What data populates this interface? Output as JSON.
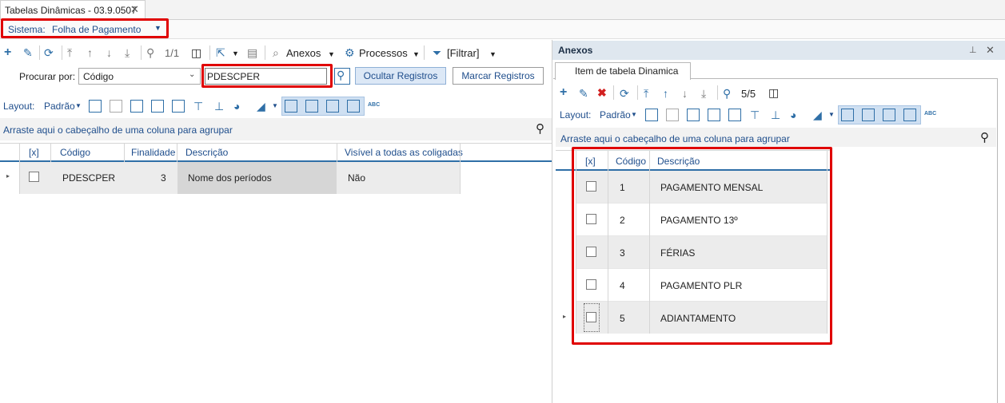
{
  "window": {
    "tab_title": "Tabelas Dinâmicas - 03.9.0507",
    "tab_close": "✕"
  },
  "sistema": {
    "label": "Sistema:",
    "value": "Folha de Pagamento",
    "arrow": "▼"
  },
  "toolbar": {
    "record_position": "1/1",
    "anexos_label": "Anexos",
    "processos_label": "Processos",
    "filtrar_label": "[Filtrar]"
  },
  "search": {
    "procurar_label": "Procurar por:",
    "field_value": "Código",
    "search_value": "PDESCPER",
    "ocultar_button": "Ocultar Registros",
    "marcar_button": "Marcar Registros"
  },
  "layout_bar": {
    "label": "Layout:",
    "value": "Padrão",
    "abc": "ABC"
  },
  "left_grid": {
    "group_hint": "Arraste aqui o cabeçalho de uma coluna para agrupar",
    "columns": [
      "[x]",
      "Código",
      "Finalidade",
      "Descrição",
      "Visível a todas as coligadas"
    ],
    "rows": [
      {
        "codigo": "PDESCPER",
        "finalidade": "3",
        "descricao": "Nome dos períodos",
        "visivel": "Não"
      }
    ]
  },
  "right_panel": {
    "title": "Anexos",
    "pin": "⊥",
    "close": "✕",
    "inner_tab": "Item de tabela Dinamica",
    "record_position": "5/5",
    "layout_label": "Layout:",
    "layout_value": "Padrão",
    "abc": "ABC",
    "group_hint": "Arraste aqui o cabeçalho de uma coluna para agrupar",
    "columns": [
      "[x]",
      "Código",
      "Descrição"
    ],
    "rows": [
      {
        "codigo": "1",
        "descricao": "PAGAMENTO MENSAL"
      },
      {
        "codigo": "2",
        "descricao": "PAGAMENTO 13º"
      },
      {
        "codigo": "3",
        "descricao": "FÉRIAS"
      },
      {
        "codigo": "4",
        "descricao": "PAGAMENTO PLR"
      },
      {
        "codigo": "5",
        "descricao": "ADIANTAMENTO"
      }
    ]
  },
  "colors": {
    "accent": "#2f6fa7",
    "highlight_red": "#e00000",
    "delete_red": "#d22020"
  }
}
